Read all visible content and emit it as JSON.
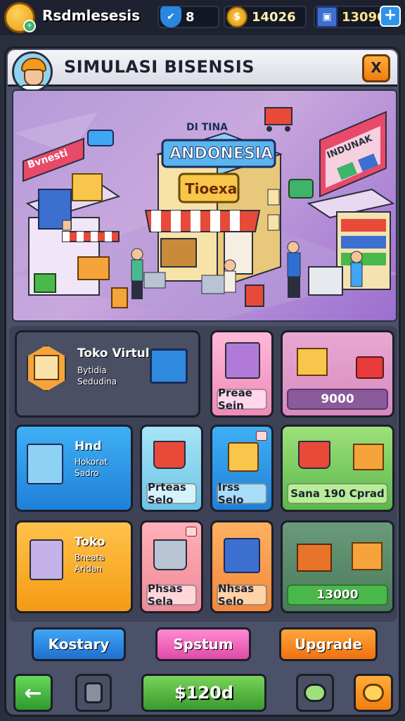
{
  "top_bar": {
    "player_name": "Rsdmlesesis",
    "gems": "8",
    "coins": "14026",
    "boxes": "13090",
    "plus_label": "+"
  },
  "panel": {
    "title": "SIMULASI BISENSIS",
    "close_label": "X"
  },
  "scene": {
    "main_sign": "ANDONESIA",
    "main_sign_top": "DI TINA",
    "store_sign": "Tioexa",
    "left_sign": "Bvnesti",
    "right_sign": "INDUNAK"
  },
  "cards": {
    "toko_virtul": {
      "title": "Toko Virtul",
      "line1": "Bytidia",
      "line2": "Sedudina"
    },
    "pink_box": {
      "label": "Preae Sein"
    },
    "gift": {
      "label": "9000"
    },
    "hnd": {
      "title": "Hnd",
      "line1": "Hokorat",
      "line2": "Sadro"
    },
    "cart_sale": {
      "label": "Prteas Selo"
    },
    "bag_sale": {
      "label": "Irss Selo"
    },
    "green_sale": {
      "label": "Sana 190 Cprad"
    },
    "toko": {
      "title": "Toko",
      "line1": "Bneata Aridan"
    },
    "red_cart": {
      "label": "Phsas Sela"
    },
    "stack_sale": {
      "label": "Nhsas Selo"
    },
    "dark_green": {
      "label": "13000"
    }
  },
  "actions": {
    "kostary": "Kostary",
    "spstum": "Spstum",
    "upgrade": "Upgrade"
  },
  "bottom_bar": {
    "back_icon": "←",
    "money": "$120d"
  },
  "colors": {
    "accent_orange": "#f07d10",
    "accent_blue": "#1f6fcf",
    "accent_pink": "#e04aa9",
    "accent_green": "#3a9a2e"
  }
}
